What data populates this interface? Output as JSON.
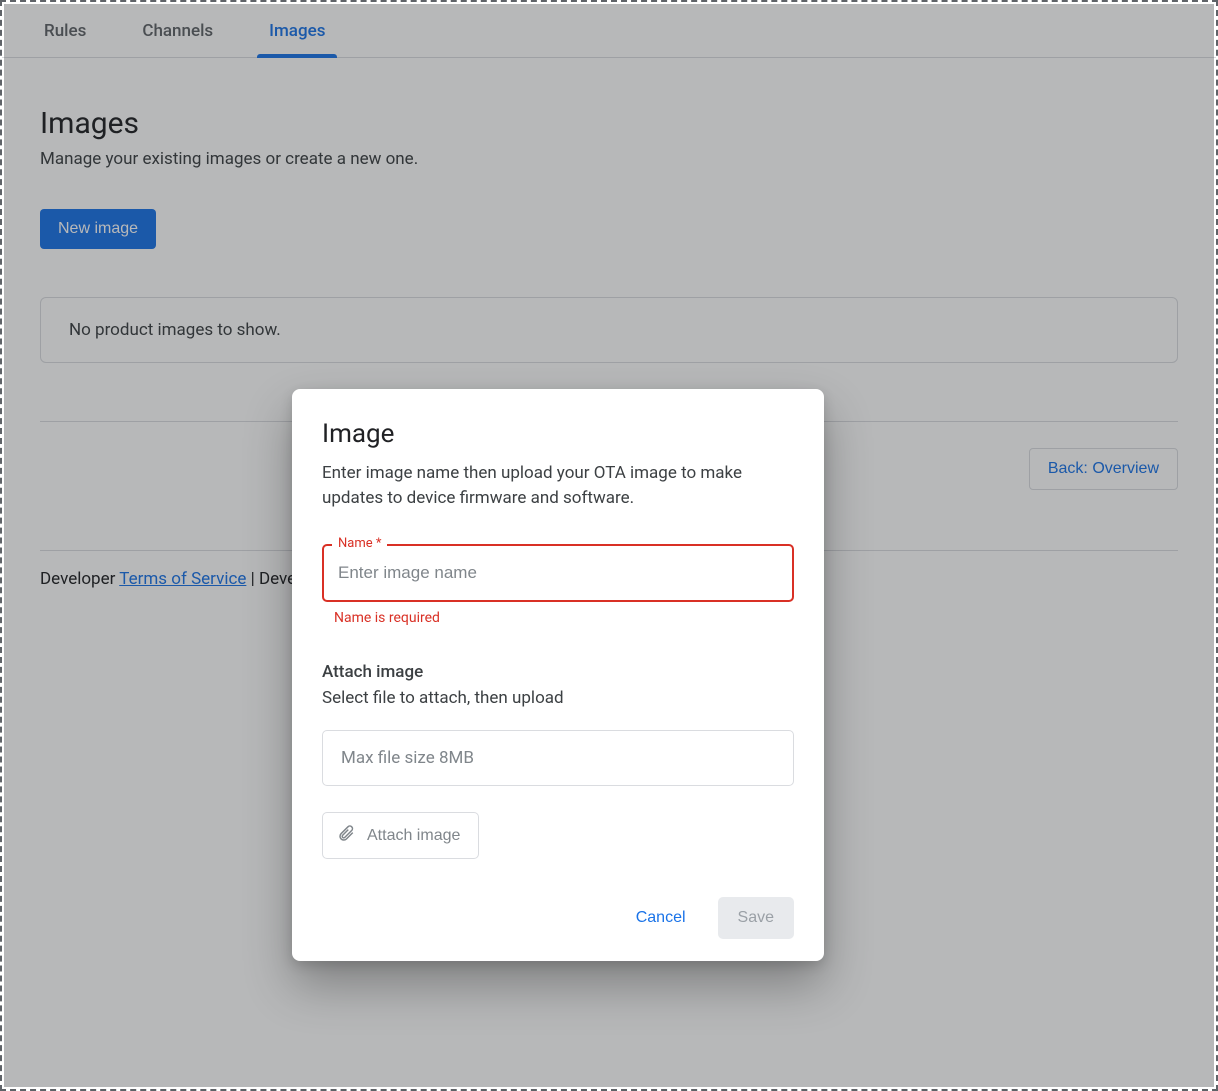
{
  "tabs": {
    "items": [
      {
        "label": "Rules",
        "active": false
      },
      {
        "label": "Channels",
        "active": false
      },
      {
        "label": "Images",
        "active": true
      }
    ]
  },
  "page": {
    "title": "Images",
    "description": "Manage your existing images or create a new one.",
    "new_button": "New image",
    "empty_message": "No product images to show.",
    "back_button": "Back: Overview"
  },
  "footer": {
    "prefix1": "Developer ",
    "tos_link": "Terms of Service",
    "between": " | Devel"
  },
  "dialog": {
    "title": "Image",
    "description": "Enter image name then upload your OTA image to make updates to device firmware and software.",
    "name_field": {
      "label": "Name *",
      "placeholder": "Enter image name",
      "value": "",
      "error": "Name is required"
    },
    "attach": {
      "heading": "Attach image",
      "sub": "Select file to attach, then upload",
      "file_hint": "Max file size 8MB",
      "button": "Attach image"
    },
    "actions": {
      "cancel": "Cancel",
      "save": "Save"
    }
  }
}
